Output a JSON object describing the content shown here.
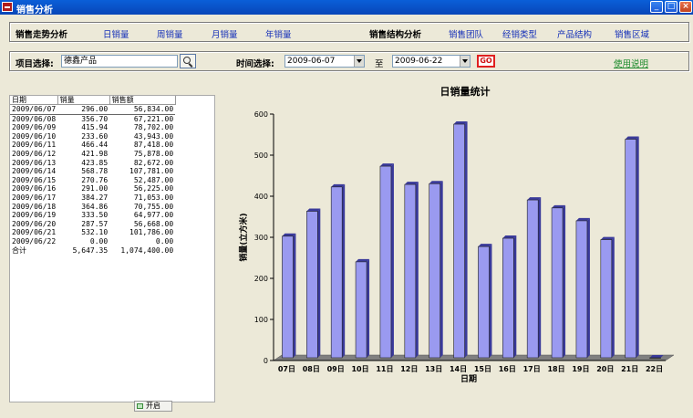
{
  "window": {
    "title": "销售分析"
  },
  "nav": {
    "trend_head": "销售走势分析",
    "daily": "日销量",
    "weekly": "周销量",
    "monthly": "月销量",
    "yearly": "年销量",
    "structure_head": "销售结构分析",
    "team": "销售团队",
    "dealer_type": "经销类型",
    "product_structure": "产品结构",
    "region": "销售区域"
  },
  "filter": {
    "item_label": "项目选择:",
    "item_value": "德鑫产品",
    "time_label": "时间选择:",
    "start_date": "2009-06-07",
    "to_label": "至",
    "end_date": "2009-06-22",
    "go_label": "GO",
    "help_link": "使用说明"
  },
  "table": {
    "headers": [
      "日期",
      "销量",
      "销售额"
    ],
    "rows": [
      [
        "2009/06/07",
        "296.00",
        "56,834.00"
      ],
      [
        "2009/06/08",
        "356.70",
        "67,221.00"
      ],
      [
        "2009/06/09",
        "415.94",
        "78,702.00"
      ],
      [
        "2009/06/10",
        "233.60",
        "43,943.00"
      ],
      [
        "2009/06/11",
        "466.44",
        "87,418.00"
      ],
      [
        "2009/06/12",
        "421.98",
        "75,878.00"
      ],
      [
        "2009/06/13",
        "423.85",
        "82,672.00"
      ],
      [
        "2009/06/14",
        "568.78",
        "107,781.00"
      ],
      [
        "2009/06/15",
        "270.76",
        "52,487.00"
      ],
      [
        "2009/06/16",
        "291.00",
        "56,225.00"
      ],
      [
        "2009/06/17",
        "384.27",
        "71,053.00"
      ],
      [
        "2009/06/18",
        "364.86",
        "70,755.00"
      ],
      [
        "2009/06/19",
        "333.50",
        "64,977.00"
      ],
      [
        "2009/06/20",
        "287.57",
        "56,668.00"
      ],
      [
        "2009/06/21",
        "532.10",
        "101,786.00"
      ],
      [
        "2009/06/22",
        "0.00",
        "0.00"
      ]
    ],
    "total": [
      "合计",
      "5,647.35",
      "1,074,400.00"
    ]
  },
  "open_button": "开启",
  "chart_data": {
    "type": "bar",
    "title": "日销量统计",
    "xlabel": "日期",
    "ylabel": "销量(立方米)",
    "categories": [
      "07日",
      "08日",
      "09日",
      "10日",
      "11日",
      "12日",
      "13日",
      "14日",
      "15日",
      "16日",
      "17日",
      "18日",
      "19日",
      "20日",
      "21日",
      "22日"
    ],
    "values": [
      296.0,
      356.7,
      415.94,
      233.6,
      466.44,
      421.98,
      423.85,
      568.78,
      270.76,
      291.0,
      384.27,
      364.86,
      333.5,
      287.57,
      532.1,
      0.0
    ],
    "ylim": [
      0,
      600
    ],
    "yticks": [
      0,
      100,
      200,
      300,
      400,
      500,
      600
    ],
    "bar_color": "#9a9af0",
    "bar_side_color": "#3a3a9a",
    "floor_color": "#808080"
  }
}
